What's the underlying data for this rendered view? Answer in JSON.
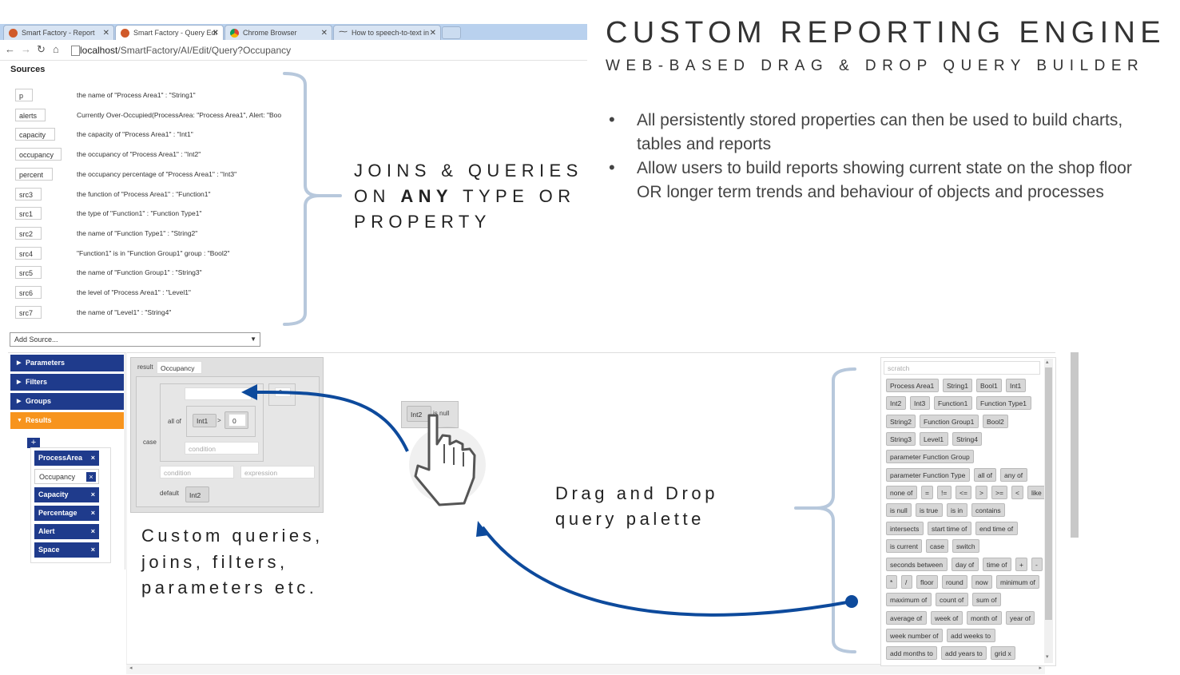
{
  "browser": {
    "tabs": [
      {
        "label": "Smart Factory - Report",
        "icon": "smart-factory-icon",
        "active": false
      },
      {
        "label": "Smart Factory - Query Edi",
        "icon": "smart-factory-icon",
        "active": true
      },
      {
        "label": "Chrome Browser",
        "icon": "chrome-icon",
        "active": false
      },
      {
        "label": "How to speech-to-text in",
        "icon": "waveform-icon",
        "active": false
      }
    ],
    "url_host": "localhost",
    "url_path": "/SmartFactory/AI/Edit/Query?Occupancy"
  },
  "header": {
    "title": "CUSTOM REPORTING ENGINE",
    "subtitle": "WEB-BASED DRAG & DROP QUERY BUILDER"
  },
  "bullets": [
    "All persistently stored properties can then be used to build charts, tables and reports",
    "Allow users to build reports showing current state on the shop floor OR longer term trends and behaviour of objects and processes"
  ],
  "callouts": {
    "joins_line1": "JOINS & QUERIES",
    "joins_line2_pre": "ON",
    "joins_line2_bold": "ANY",
    "joins_line2_post": "TYPE OR",
    "joins_line3": "PROPERTY",
    "palette_line1": "Drag and Drop",
    "palette_line2": "query palette",
    "custom_line1": "Custom queries,",
    "custom_line2": "joins, filters,",
    "custom_line3": "parameters etc."
  },
  "sources": {
    "label": "Sources",
    "items": [
      {
        "name": "p",
        "desc": "the name of \"Process Area1\" : \"String1\""
      },
      {
        "name": "alerts",
        "desc": "Currently Over-Occupied(ProcessArea: \"Process Area1\", Alert: \"Boo"
      },
      {
        "name": "capacity",
        "desc": "the capacity of \"Process Area1\" : \"Int1\""
      },
      {
        "name": "occupancy",
        "desc": "the occupancy of \"Process Area1\" : \"Int2\""
      },
      {
        "name": "percent",
        "desc": "the occupancy percentage of \"Process Area1\" : \"Int3\""
      },
      {
        "name": "src3",
        "desc": "the function of \"Process Area1\" : \"Function1\""
      },
      {
        "name": "src1",
        "desc": "the type of \"Function1\" : \"Function Type1\""
      },
      {
        "name": "src2",
        "desc": "the name of \"Function Type1\" : \"String2\""
      },
      {
        "name": "src4",
        "desc": "\"Function1\" is in \"Function Group1\" group : \"Bool2\""
      },
      {
        "name": "src5",
        "desc": "the name of \"Function Group1\" : \"String3\""
      },
      {
        "name": "src6",
        "desc": "the level of \"Process Area1\" : \"Level1\""
      },
      {
        "name": "src7",
        "desc": "the name of \"Level1\" : \"String4\""
      }
    ],
    "add_source": "Add Source...",
    "add_source_arrow": "▼"
  },
  "sidebar": {
    "sections": [
      "Parameters",
      "Filters",
      "Groups",
      "Results"
    ],
    "plus": "+",
    "results": [
      {
        "label": "ProcessArea",
        "selected": false
      },
      {
        "label": "Occupancy",
        "selected": true
      },
      {
        "label": "Capacity",
        "selected": false
      },
      {
        "label": "Percentage",
        "selected": false
      },
      {
        "label": "Alert",
        "selected": false
      },
      {
        "label": "Space",
        "selected": false
      }
    ],
    "remove": "×"
  },
  "query": {
    "result_label": "result",
    "result_value": "Occupancy",
    "case_label": "case",
    "allof_label": "all of",
    "chip_int1": "Int1",
    "gt": ">",
    "zero": "0",
    "condition_ph": "condition",
    "expression_ph": "expression",
    "default_label": "default",
    "chip_int2": "Int2",
    "small_field": "0"
  },
  "drag": {
    "chip": "Int2",
    "label": "is null"
  },
  "palette": {
    "scratch_placeholder": "scratch",
    "rows": [
      [
        "Process Area1",
        "String1",
        "Bool1",
        "Int1"
      ],
      [
        "Int2",
        "Int3",
        "Function1",
        "Function Type1"
      ],
      [
        "String2",
        "Function Group1",
        "Bool2"
      ],
      [
        "String3",
        "Level1",
        "String4"
      ],
      [
        "parameter Function Group"
      ],
      [
        "parameter Function Type",
        "all of",
        "any of"
      ],
      [
        "none of",
        "=",
        "!=",
        "<=",
        ">",
        ">=",
        "<",
        "like"
      ],
      [
        "is null",
        "is true",
        "is in",
        "contains"
      ],
      [
        "intersects",
        "start time of",
        "end time of"
      ],
      [
        "is current",
        "case",
        "switch"
      ],
      [
        "seconds between",
        "day of",
        "time of",
        "+",
        "-"
      ],
      [
        "*",
        "/",
        "floor",
        "round",
        "now",
        "minimum of"
      ],
      [
        "maximum of",
        "count of",
        "sum of"
      ],
      [
        "average of",
        "week of",
        "month of",
        "year of"
      ],
      [
        "week number of",
        "add weeks to"
      ],
      [
        "add months to",
        "add years to",
        "grid x"
      ]
    ]
  },
  "colors": {
    "accent": "#1f3b8c",
    "orange": "#f7941d",
    "arrow": "#0d4a9c",
    "brace": "#b7c8dc"
  }
}
